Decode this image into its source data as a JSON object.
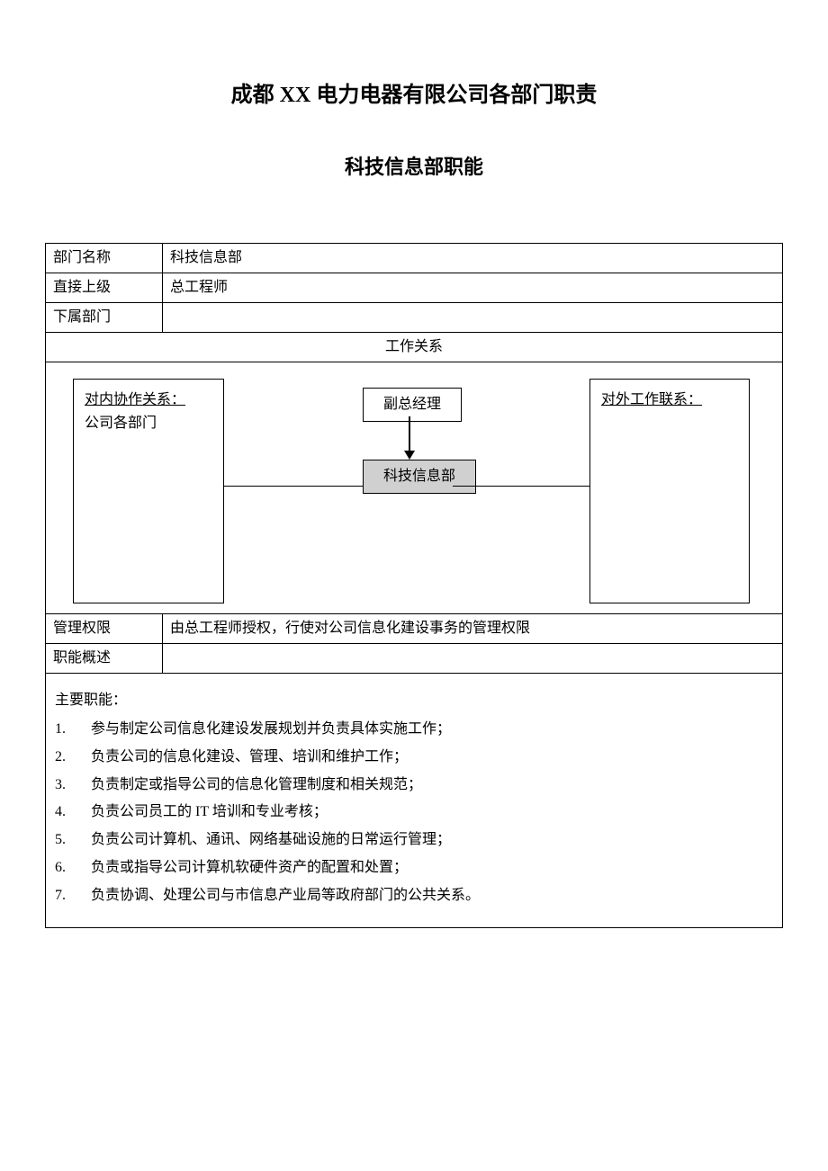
{
  "main_title": "成都 XX 电力电器有限公司各部门职责",
  "sub_title": "科技信息部职能",
  "rows": {
    "dept_label": "部门名称",
    "dept_value": "科技信息部",
    "supervisor_label": "直接上级",
    "supervisor_value": "总工程师",
    "sub_dept_label": "下属部门",
    "sub_dept_value": "",
    "work_rel_header": "工作关系",
    "authority_label": "管理权限",
    "authority_value": "由总工程师授权，行使对公司信息化建设事务的管理权限",
    "summary_label": "职能概述",
    "summary_value": ""
  },
  "diagram": {
    "internal_label": "对内协作关系：",
    "internal_value": "公司各部门",
    "external_label": "对外工作联系：",
    "top_box": "副总经理",
    "bottom_box": "科技信息部"
  },
  "duties": {
    "heading": "主要职能：",
    "items": [
      {
        "num": "1.",
        "text": "参与制定公司信息化建设发展规划并负责具体实施工作；"
      },
      {
        "num": "2.",
        "text": "负责公司的信息化建设、管理、培训和维护工作；"
      },
      {
        "num": "3.",
        "text": "负责制定或指导公司的信息化管理制度和相关规范；"
      },
      {
        "num": "4.",
        "text": "负责公司员工的 IT 培训和专业考核；"
      },
      {
        "num": "5.",
        "text": "负责公司计算机、通讯、网络基础设施的日常运行管理；"
      },
      {
        "num": "6.",
        "text": "负责或指导公司计算机软硬件资产的配置和处置；"
      },
      {
        "num": "7.",
        "text": "负责协调、处理公司与市信息产业局等政府部门的公共关系。"
      }
    ]
  }
}
